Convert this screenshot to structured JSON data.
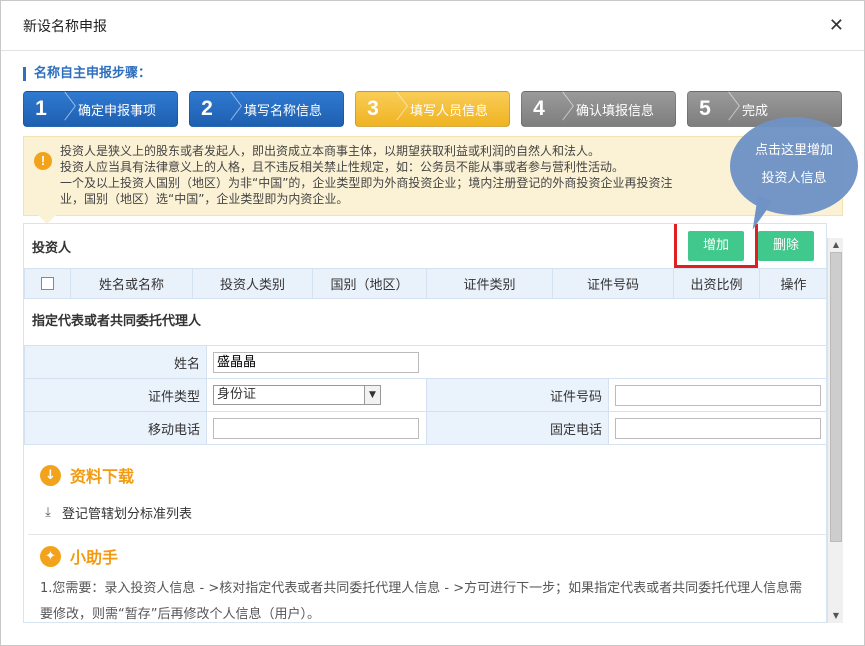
{
  "dialog": {
    "title": "新设名称申报"
  },
  "steps": {
    "heading": "名称自主申报步骤：",
    "items": [
      {
        "num": "1",
        "label": "确定申报事项"
      },
      {
        "num": "2",
        "label": "填写名称信息"
      },
      {
        "num": "3",
        "label": "填写人员信息"
      },
      {
        "num": "4",
        "label": "确认填报信息"
      },
      {
        "num": "5",
        "label": "完成"
      }
    ]
  },
  "notice": {
    "icon": "!",
    "lines": [
      "投资人是狭义上的股东或者发起人，即出资成立本商事主体，以期望获取利益或利润的自然人和法人。",
      "投资人应当具有法律意义上的人格，且不违反相关禁止性规定，如：公务员不能从事或者参与营利性活动。",
      "一个及以上投资人国别（地区）为非“中国”的，企业类型即为外商投资企业；境内注册登记的外商投资企业再投资注",
      "业，国别（地区）选“中国”，企业类型即为内资企业。"
    ]
  },
  "tooltip": {
    "line1": "点击这里增加",
    "line2": "投资人信息"
  },
  "investor": {
    "title": "投资人",
    "add_label": "增加",
    "delete_label": "删除",
    "columns": [
      "姓名或名称",
      "投资人类别",
      "国别（地区）",
      "证件类别",
      "证件号码",
      "出资比例",
      "操作"
    ]
  },
  "agent": {
    "title": "指定代表或者共同委托代理人",
    "name_label": "姓名",
    "name_value": "盛晶晶",
    "id_type_label": "证件类型",
    "id_type_value": "身份证",
    "id_no_label": "证件号码",
    "id_no_value": "",
    "mobile_label": "移动电话",
    "mobile_value": "",
    "phone_label": "固定电话",
    "phone_value": ""
  },
  "download": {
    "title": "资料下载",
    "link": "登记管辖划分标准列表"
  },
  "helper": {
    "title": "小助手",
    "text1": "1.您需要：录入投资人信息 - >核对指定代表或者共同委托代理人信息 - >方可进行下一步；如果指定代表或者共同委托代理人信息需",
    "text2": "要修改，则需“暂存”后再修改个人信息（用户）。"
  },
  "colors": {
    "step_done": "#2f7ad2",
    "step_current": "#f0b323",
    "step_todo": "#8a8a8a",
    "add_button": "#41c88c",
    "highlight": "#e02020",
    "accent": "#f29b12"
  }
}
